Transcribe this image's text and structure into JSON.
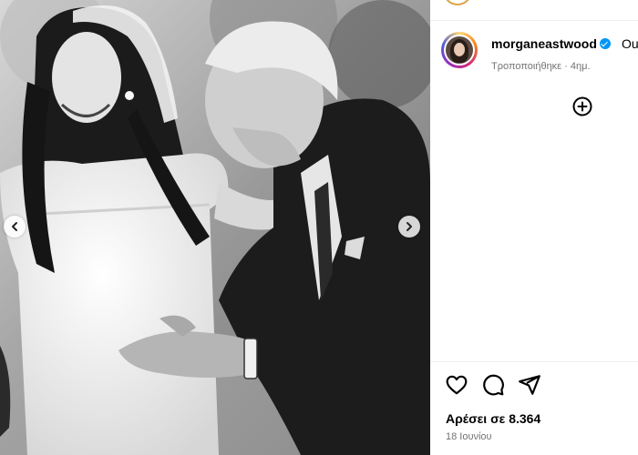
{
  "post": {
    "username": "morganeastwood",
    "caption_start": "Our p",
    "edited_label": "Τροποποιήθηκε",
    "time_ago": "4ημ.",
    "likes_text": "Αρέσει σε 8.364",
    "date": "18 Ιουνίου"
  },
  "icons": {
    "prev": "chevron-left-icon",
    "next": "chevron-right-icon",
    "add": "plus-circle-icon",
    "like": "heart-icon",
    "comment": "comment-icon",
    "share": "share-icon",
    "verified": "verified-badge-icon"
  },
  "colors": {
    "verified_blue": "#0095f6",
    "muted_text": "#737373",
    "story_ring_start": "#feda75",
    "story_ring_end": "#962fbf"
  }
}
